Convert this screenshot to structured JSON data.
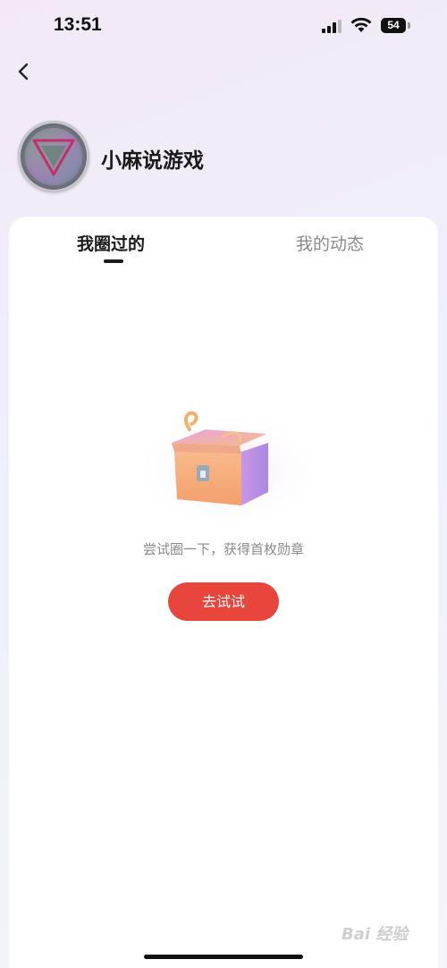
{
  "status_bar": {
    "time": "13:51",
    "battery": "54"
  },
  "header": {
    "back_icon": "chevron-left-icon"
  },
  "profile": {
    "name": "小麻说游戏",
    "avatar_icon": "triangle-logo-avatar"
  },
  "tabs": [
    {
      "label": "我圈过的",
      "active": true
    },
    {
      "label": "我的动态",
      "active": false
    }
  ],
  "empty_state": {
    "illustration": "treasure-chest-icon",
    "message": "尝试圈一下，获得首枚勋章",
    "button_label": "去试试"
  },
  "watermark": {
    "text": "Bai 经验"
  },
  "colors": {
    "accent": "#e8453c",
    "text_primary": "#1a1a1a",
    "text_secondary": "#8a8a8a"
  }
}
